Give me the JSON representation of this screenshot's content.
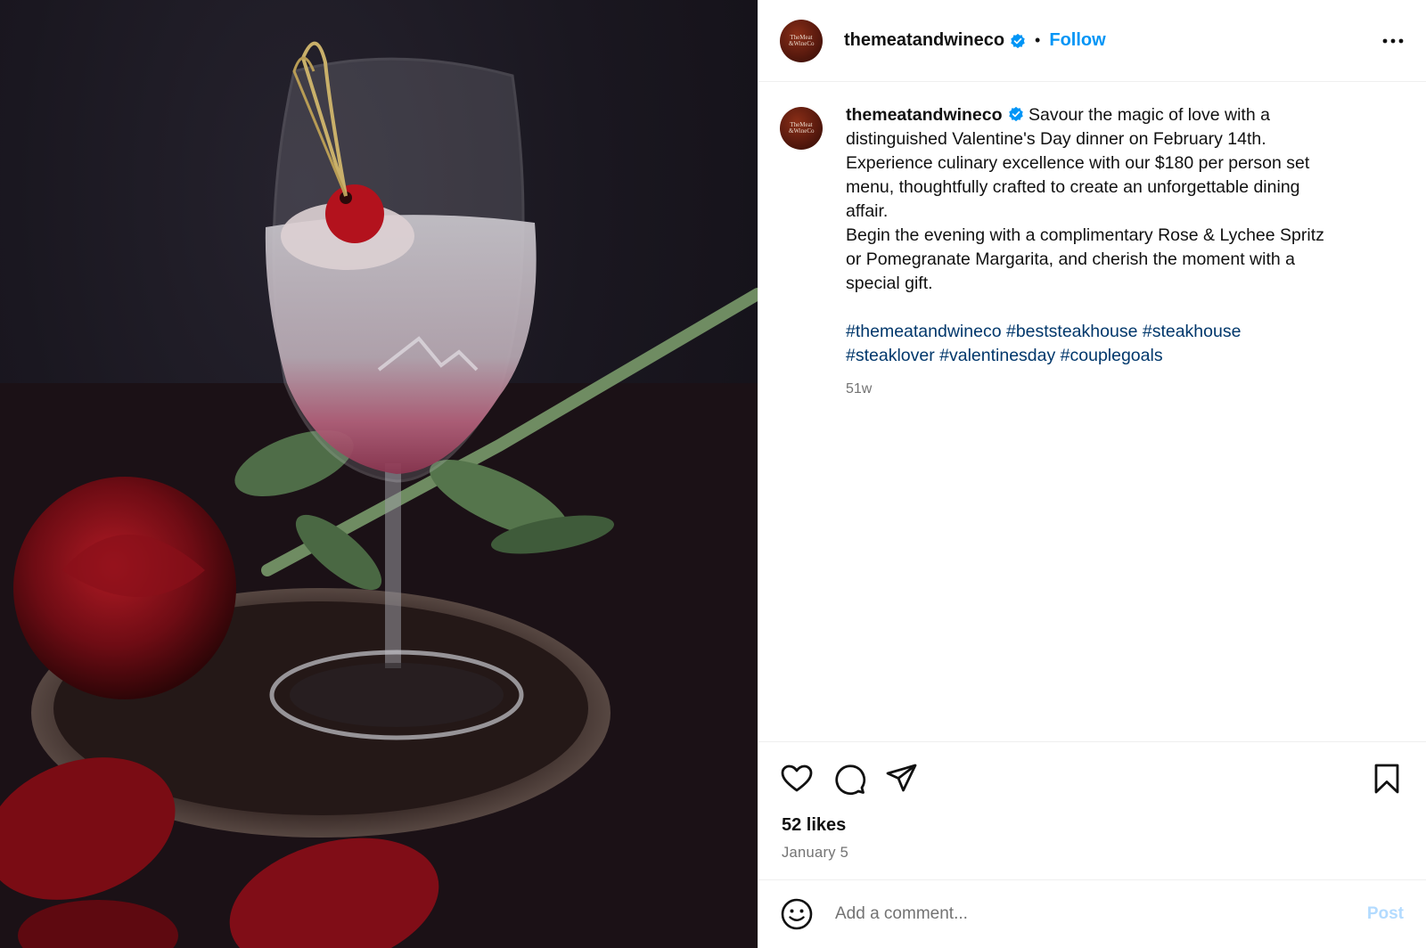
{
  "header": {
    "avatar_text": "TheMeat\n&WineCo",
    "username": "themeatandwineco",
    "dot": "•",
    "follow_label": "Follow"
  },
  "caption": {
    "username": "themeatandwineco",
    "lines": [
      "Savour the magic of love with a",
      "distinguished Valentine's Day dinner on February 14th.",
      "Experience culinary excellence with our $180 per person set",
      "menu, thoughtfully crafted to create an unforgettable dining",
      "affair.",
      "Begin the evening with a complimentary Rose & Lychee Spritz",
      "or Pomegranate Margarita, and cherish the moment with a",
      "special gift."
    ],
    "hashtags": [
      "#themeatandwineco",
      "#beststeakhouse",
      "#steakhouse",
      "#steaklover",
      "#valentinesday",
      "#couplegoals"
    ],
    "age": "51w"
  },
  "actions": {
    "icons": [
      "heart-icon",
      "comment-icon",
      "share-icon",
      "bookmark-icon"
    ]
  },
  "likes_text": "52 likes",
  "date_text": "January 5",
  "comment": {
    "placeholder": "Add a comment...",
    "post_label": "Post"
  },
  "colors": {
    "link_blue": "#0095f6",
    "hashtag_blue": "#00376b",
    "muted": "#737373",
    "post_disabled": "#b3dbff",
    "verified": "#0095f6"
  }
}
